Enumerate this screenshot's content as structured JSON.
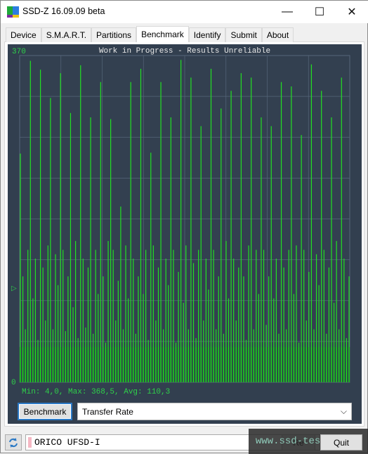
{
  "window": {
    "title": "SSD-Z 16.09.09 beta",
    "minimize": "—",
    "maximize": "☐",
    "close": "✕"
  },
  "tabs": [
    {
      "label": "Device"
    },
    {
      "label": "S.M.A.R.T."
    },
    {
      "label": "Partitions"
    },
    {
      "label": "Benchmark",
      "active": true
    },
    {
      "label": "Identify"
    },
    {
      "label": "Submit"
    },
    {
      "label": "About"
    }
  ],
  "chart_data": {
    "type": "area",
    "title": "Work in Progress - Results Unreliable",
    "ylim": [
      0,
      370
    ],
    "y_tick_labels": [
      "370",
      "0"
    ],
    "grid": true,
    "stats": "Min: 4,0, Max: 368,5, Avg: 110,3",
    "colors": {
      "background": "#323f4f",
      "plot": "#334050",
      "grid": "#56667a",
      "line": "#22e022",
      "fill": "#1d6a2e",
      "text_title": "#e8e8e8",
      "text_axis": "#2fd04a"
    },
    "values": [
      259,
      120,
      60,
      150,
      364,
      95,
      140,
      48,
      354,
      130,
      70,
      155,
      322,
      60,
      145,
      110,
      350,
      150,
      58,
      120,
      305,
      85,
      160,
      50,
      359,
      140,
      62,
      130,
      300,
      55,
      150,
      100,
      340,
      120,
      45,
      160,
      298,
      150,
      70,
      115,
      199,
      60,
      155,
      95,
      340,
      140,
      55,
      120,
      355,
      100,
      150,
      48,
      260,
      155,
      70,
      130,
      340,
      60,
      140,
      110,
      300,
      150,
      45,
      125,
      365,
      90,
      155,
      60,
      345,
      135,
      50,
      150,
      290,
      70,
      140,
      105,
      355,
      150,
      60,
      120,
      310,
      55,
      160,
      95,
      330,
      140,
      70,
      130,
      350,
      120,
      48,
      155,
      345,
      60,
      150,
      100,
      300,
      150,
      65,
      120,
      290,
      95,
      140,
      55,
      340,
      130,
      60,
      150,
      335,
      100,
      155,
      45,
      280,
      150,
      70,
      125,
      360,
      60,
      145,
      110,
      330,
      150,
      55,
      130,
      300,
      90,
      160,
      60,
      345,
      140,
      50,
      120
    ]
  },
  "controls": {
    "benchmark_button": "Benchmark",
    "mode_select": "Transfer Rate"
  },
  "status": {
    "drive_name": "ORICO UFSD-I",
    "button1": "Re",
    "button2": "Quit",
    "watermark": "www.ssd-tester.com"
  }
}
